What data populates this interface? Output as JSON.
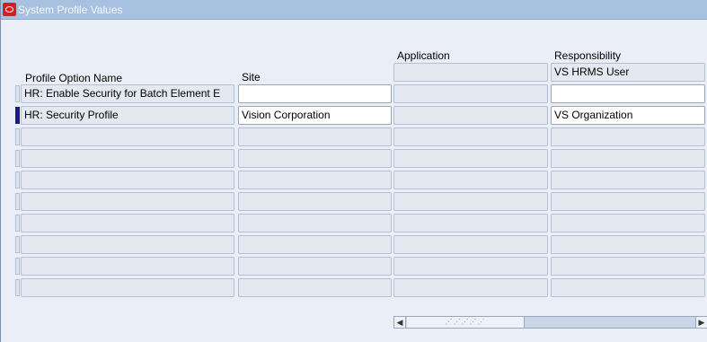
{
  "window": {
    "title": "System Profile Values"
  },
  "columns": {
    "profile_option_name": "Profile Option Name",
    "site": "Site",
    "application": "Application",
    "responsibility": "Responsibility"
  },
  "header_row": {
    "application_value": "",
    "responsibility_value": "VS HRMS User"
  },
  "rows": [
    {
      "name": "HR: Enable Security for Batch Element E",
      "site": "",
      "application": "",
      "responsibility": ""
    },
    {
      "name": "HR: Security Profile",
      "site": "Vision Corporation",
      "application": "",
      "responsibility": "VS Organization"
    },
    {
      "name": "",
      "site": "",
      "application": "",
      "responsibility": ""
    },
    {
      "name": "",
      "site": "",
      "application": "",
      "responsibility": ""
    },
    {
      "name": "",
      "site": "",
      "application": "",
      "responsibility": ""
    },
    {
      "name": "",
      "site": "",
      "application": "",
      "responsibility": ""
    },
    {
      "name": "",
      "site": "",
      "application": "",
      "responsibility": ""
    },
    {
      "name": "",
      "site": "",
      "application": "",
      "responsibility": ""
    },
    {
      "name": "",
      "site": "",
      "application": "",
      "responsibility": ""
    },
    {
      "name": "",
      "site": "",
      "application": "",
      "responsibility": ""
    }
  ],
  "icons": {
    "app": "oracle-icon",
    "scroll_left": "scroll-left-arrow-icon",
    "scroll_right": "scroll-right-arrow-icon",
    "scroll_grip": "scroll-grip-icon"
  },
  "colors": {
    "active_row_indicator": "#1a1a8c",
    "title_bar": "#a9c1e0",
    "background": "#eaeef6"
  }
}
